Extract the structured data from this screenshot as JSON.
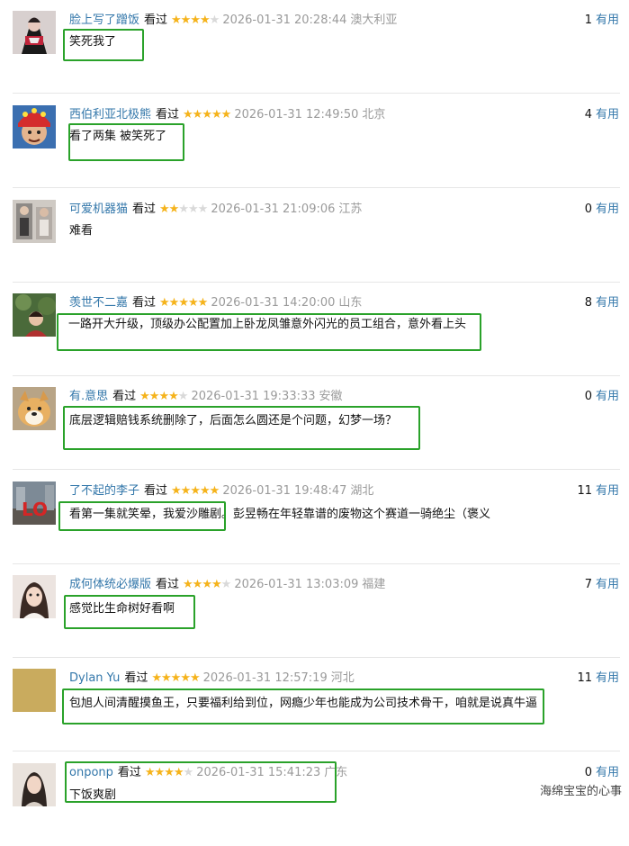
{
  "watched_label": "看过",
  "useful_label": "有用",
  "watermark": "海绵宝宝的心事",
  "colors": {
    "username": "#3377aa",
    "star_on": "#f5b31b",
    "star_off": "#d9d9d9",
    "highlight": "#2aa22a",
    "meta_gray": "#9a9a9a"
  },
  "comments": [
    {
      "user": "脸上写了蹭饭",
      "rating": 4,
      "time": "2026-01-31 20:28:44",
      "location": "澳大利亚",
      "votes": "1",
      "text": "笑死我了"
    },
    {
      "user": "西伯利亚北极熊",
      "rating": 5,
      "time": "2026-01-31 12:49:50",
      "location": "北京",
      "votes": "4",
      "text": "看了两集 被笑死了"
    },
    {
      "user": "可爱机器猫",
      "rating": 2,
      "time": "2026-01-31 21:09:06",
      "location": "江苏",
      "votes": "0",
      "text": "难看"
    },
    {
      "user": "羡世不二嘉",
      "rating": 5,
      "time": "2026-01-31 14:20:00",
      "location": "山东",
      "votes": "8",
      "text": "一路开大升级，顶级办公配置加上卧龙凤雏意外闪光的员工组合，意外看上头"
    },
    {
      "user": "有.意思",
      "rating": 4,
      "time": "2026-01-31 19:33:33",
      "location": "安徽",
      "votes": "0",
      "text": "底层逻辑赔钱系统删除了，后面怎么圆还是个问题，幻梦一场？"
    },
    {
      "user": "了不起的李子",
      "rating": 5,
      "time": "2026-01-31 19:48:47",
      "location": "湖北",
      "votes": "11",
      "text": "看第一集就笑晕，我爱沙雕剧。彭昱畅在年轻靠谱的废物这个赛道一骑绝尘（褒义"
    },
    {
      "user": "成何体统必爆版",
      "rating": 4,
      "time": "2026-01-31 13:03:09",
      "location": "福建",
      "votes": "7",
      "text": "感觉比生命树好看啊"
    },
    {
      "user": "Dylan Yu",
      "rating": 5,
      "time": "2026-01-31 12:57:19",
      "location": "河北",
      "votes": "11",
      "text": "包旭人间清醒摸鱼王，只要福利给到位，网瘾少年也能成为公司技术骨干，咱就是说真牛逼"
    },
    {
      "user": "onponp",
      "rating": 4,
      "time": "2026-01-31 15:41:23",
      "location": "广东",
      "votes": "0",
      "text": "下饭爽剧"
    }
  ]
}
